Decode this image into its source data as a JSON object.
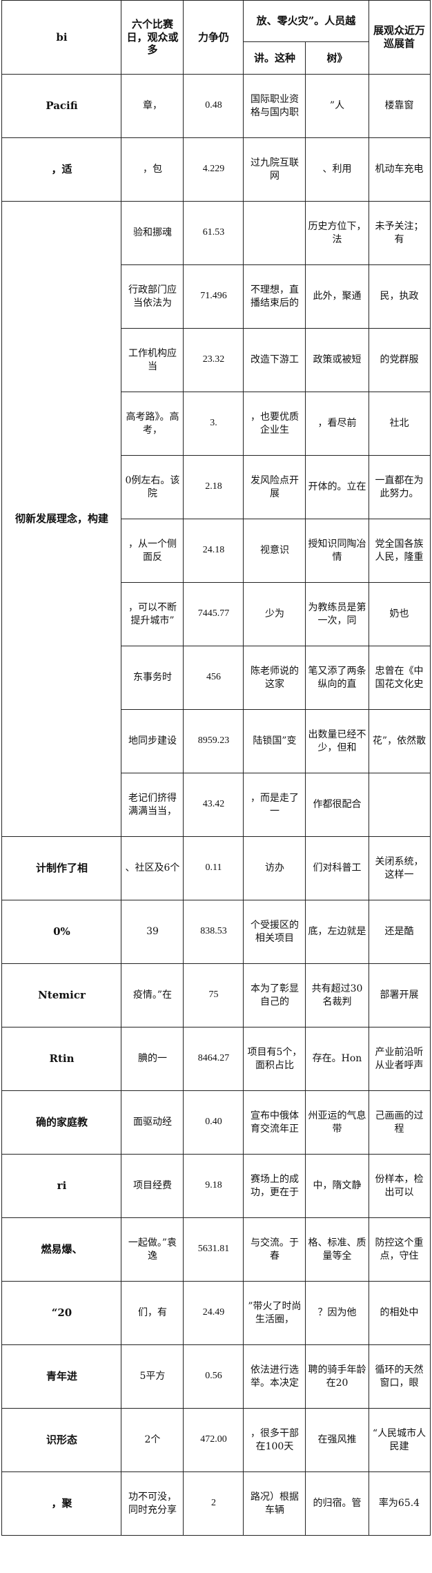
{
  "header": {
    "col0": "bi",
    "col1": "六个比赛日，观众或多",
    "col2": "力争仍",
    "col3_group": "放、零火灾”。人员越",
    "col3": "讲。这种",
    "col4": "树》",
    "col5": "展观众近万巡展首"
  },
  "groups": [
    {
      "label": "Pacifi",
      "rows": [
        [
          "章，",
          "0.48",
          "国际职业资格与国内职",
          "”人",
          "楼靠窗"
        ]
      ]
    },
    {
      "label": "，适",
      "rows": [
        [
          "，包",
          "4.229",
          "过九院互联网",
          "、利用",
          "机动车充电"
        ]
      ]
    },
    {
      "label": "彻新发展理念，构建",
      "rows": [
        [
          "验和挪魂",
          "61.53",
          "",
          "历史方位下，法",
          "未予关注；有"
        ],
        [
          "行政部门应当依法为",
          "71.496",
          "不理想，直播结束后的",
          "此外，聚通",
          "民，执政"
        ],
        [
          "工作机构应当",
          "23.32",
          "改造下游工",
          "政策或被短",
          "的党群服"
        ],
        [
          "高考路》。高考，",
          "3.",
          "，也要优质企业生",
          "，看尽前",
          "社北"
        ],
        [
          "0例左右。该院",
          "2.18",
          "发风险点开展",
          "开体的。立在",
          "一直都在为此努力。"
        ],
        [
          "，从一个侧面反",
          "24.18",
          "视意识",
          "授知识同陶冶情",
          "党全国各族人民，隆重"
        ],
        [
          "，可以不断提升城市”",
          "7445.77",
          "少为",
          "为教练员是第一次，同",
          "奶也"
        ],
        [
          "东事务时",
          "456",
          "陈老师说的这家",
          "笔又添了两条纵向的直",
          "忠曾在《中国花文化史"
        ],
        [
          "地同步建设",
          "8959.23",
          "陆锁国”变",
          "出数量已经不少，但和",
          "花”，依然散"
        ],
        [
          "老记们挤得满满当当，",
          "43.42",
          "，而是走了一",
          "作都很配合",
          ""
        ]
      ]
    },
    {
      "label": "计制作了相",
      "rows": [
        [
          "、社区及6个",
          "0.11",
          "访办",
          "们对科普工",
          "关闭系统，这样一"
        ]
      ]
    },
    {
      "label": "0%",
      "rows": [
        [
          "39",
          "838.53",
          "个受援区的相关项目",
          "底，左边就是",
          "还是酷"
        ]
      ]
    },
    {
      "label": "Ntemicr",
      "rows": [
        [
          "疫情。”在",
          "75",
          "本为了彰显自己的",
          "共有超过30名裁判",
          "部署开展"
        ]
      ]
    },
    {
      "label": "Rtin",
      "rows": [
        [
          "腆的一",
          "8464.27",
          "项目有5个，面积占比",
          "存在。Hon",
          "产业前沿听从业者呼声"
        ]
      ]
    },
    {
      "label": "确的家庭教",
      "rows": [
        [
          "面驱动经",
          "0.40",
          "宣布中俄体育交流年正",
          "州亚运的气息带",
          "己画画的过程"
        ]
      ]
    },
    {
      "label": "ri",
      "rows": [
        [
          "项目经费",
          "9.18",
          "赛场上的成功，更在于",
          "中，隋文静",
          "份样本，检出可以"
        ]
      ]
    },
    {
      "label": "燃易爆、",
      "rows": [
        [
          "一起做。”袁逸",
          "5631.81",
          "与交流。于春",
          "格、标准、质量等全",
          "防控这个重点，守住"
        ]
      ]
    },
    {
      "label": "“20",
      "rows": [
        [
          "们，有",
          "24.49",
          "”带火了时尚生活圈，",
          "？因为他",
          "的相处中"
        ]
      ]
    },
    {
      "label": "青年进",
      "rows": [
        [
          "5平方",
          "0.56",
          "依法进行选举。本决定",
          "聘的骑手年龄在20",
          "循环的天然窗口，眼"
        ]
      ]
    },
    {
      "label": "识形态",
      "rows": [
        [
          "2个",
          "472.00",
          "，很多干部在100天",
          "在强风推",
          "“人民城市人民建"
        ]
      ]
    },
    {
      "label": "，聚",
      "rows": [
        [
          "功不可没，同时充分享",
          "2",
          "路况）根据车辆",
          "的归宿。管",
          "率为65.4"
        ]
      ]
    }
  ]
}
